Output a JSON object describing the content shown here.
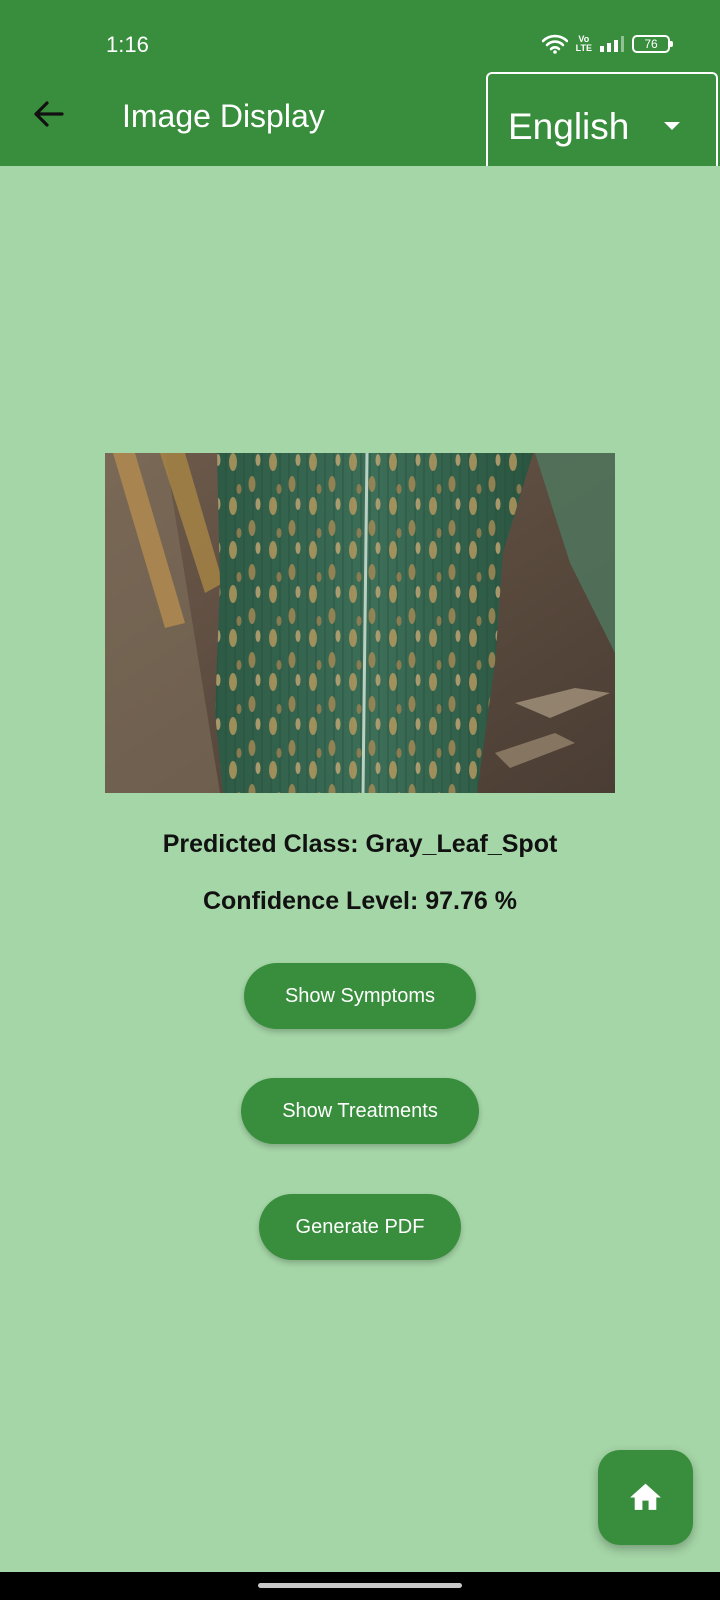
{
  "status_bar": {
    "time": "1:16",
    "volte_line1": "Vo",
    "volte_line2": "LTE",
    "battery": "76"
  },
  "app_bar": {
    "title": "Image Display",
    "language": {
      "selected": "English"
    }
  },
  "main": {
    "predicted_class": "Predicted Class: Gray_Leaf_Spot",
    "confidence": "Confidence Level: 97.76 %",
    "buttons": {
      "symptoms": "Show Symptoms",
      "treatments": "Show Treatments",
      "pdf": "Generate PDF"
    }
  },
  "colors": {
    "primary": "#388e3c",
    "background": "#a5d6a7"
  },
  "icons": {
    "back": "arrow-left-icon",
    "dropdown": "caret-down-icon",
    "home": "home-icon"
  }
}
